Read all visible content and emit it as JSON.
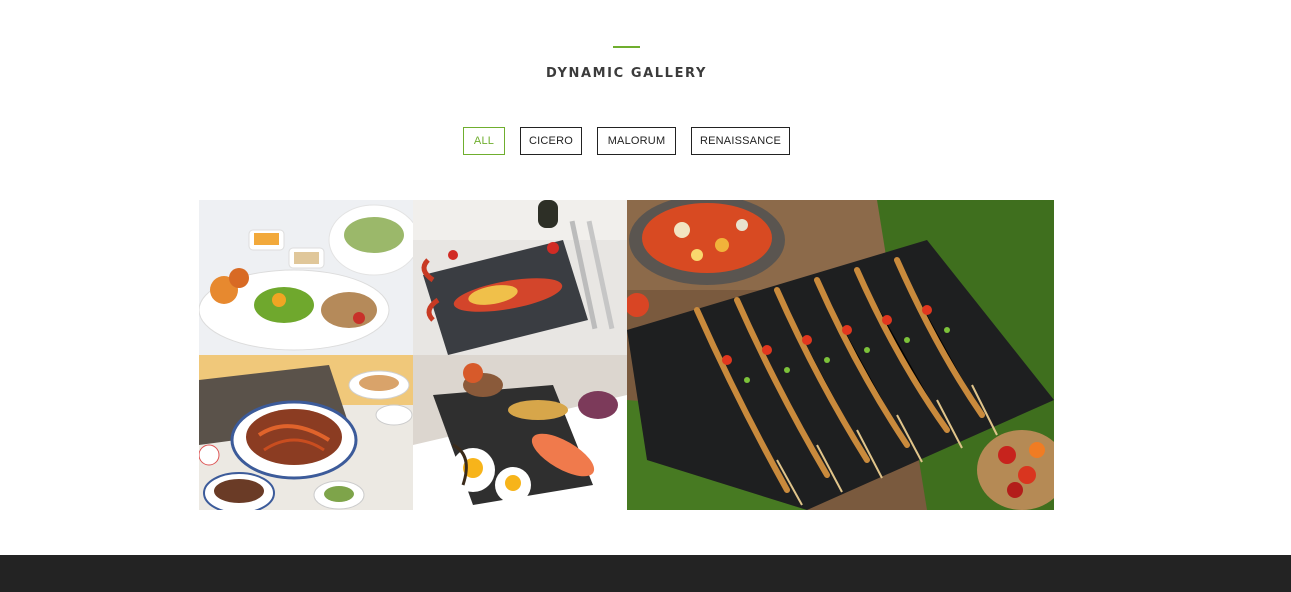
{
  "gallery": {
    "title": "DYNAMIC GALLERY",
    "accent_color": "#6fae2e",
    "filters": [
      {
        "label": "ALL",
        "active": true
      },
      {
        "label": "CICERO",
        "active": false
      },
      {
        "label": "MALORUM",
        "active": false
      },
      {
        "label": "RENAISSANCE",
        "active": false
      }
    ],
    "images": [
      {
        "subject": "bento platter with shrimp, salad and soup bowl"
      },
      {
        "subject": "grilled lobster on slate board with cutlery"
      },
      {
        "subject": "stir-fried noodles with side dishes"
      },
      {
        "subject": "smoked salmon with fried eggs on stone slab"
      },
      {
        "subject": "grilled prawn skewers on black slate over banana leaf"
      }
    ]
  },
  "footer": {
    "background": "#232323"
  }
}
